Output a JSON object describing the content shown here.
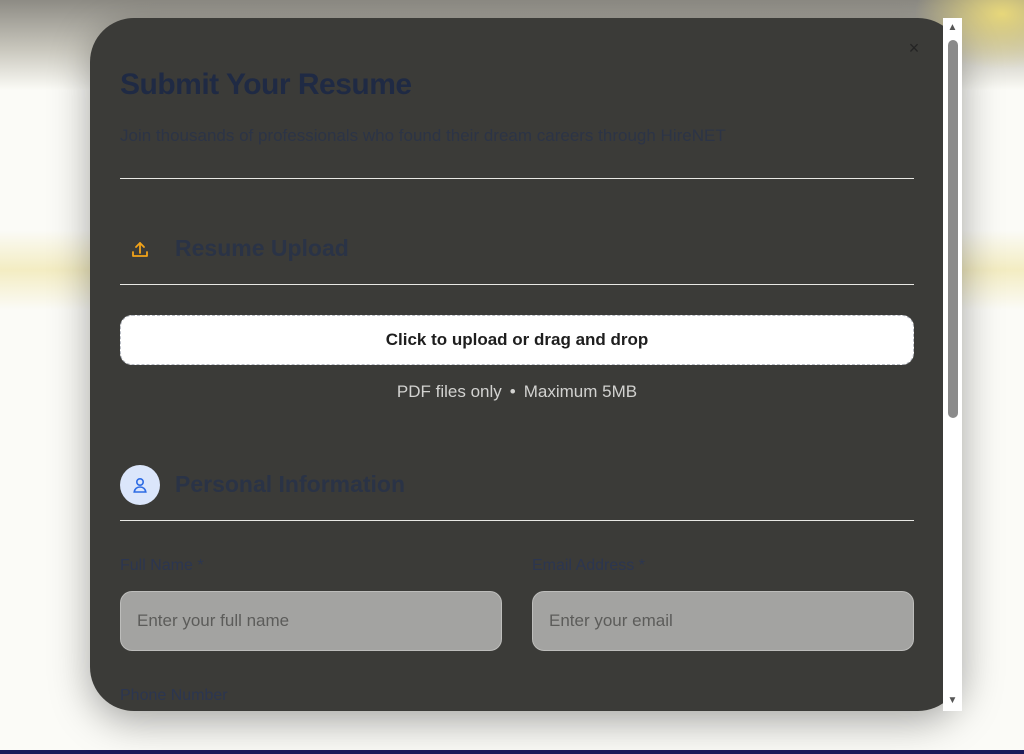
{
  "modal": {
    "close_glyph": "×",
    "title": "Submit Your Resume",
    "subtitle": "Join thousands of professionals who found their dream careers through HireNET"
  },
  "resume_section": {
    "title": "Resume Upload",
    "icon": "upload-icon",
    "icon_color": "#f2a319",
    "upload_label": "Click to upload or drag and drop",
    "hint_format": "PDF files only",
    "hint_separator": "•",
    "hint_size": "Maximum 5MB"
  },
  "personal_section": {
    "title": "Personal Information",
    "icon": "user-icon",
    "icon_color": "#2d6be4",
    "icon_bg": "#dbe6fb",
    "full_name": {
      "label": "Full Name *",
      "placeholder": "Enter your full name"
    },
    "email": {
      "label": "Email Address *",
      "placeholder": "Enter your email"
    },
    "phone": {
      "label": "Phone Number"
    }
  }
}
